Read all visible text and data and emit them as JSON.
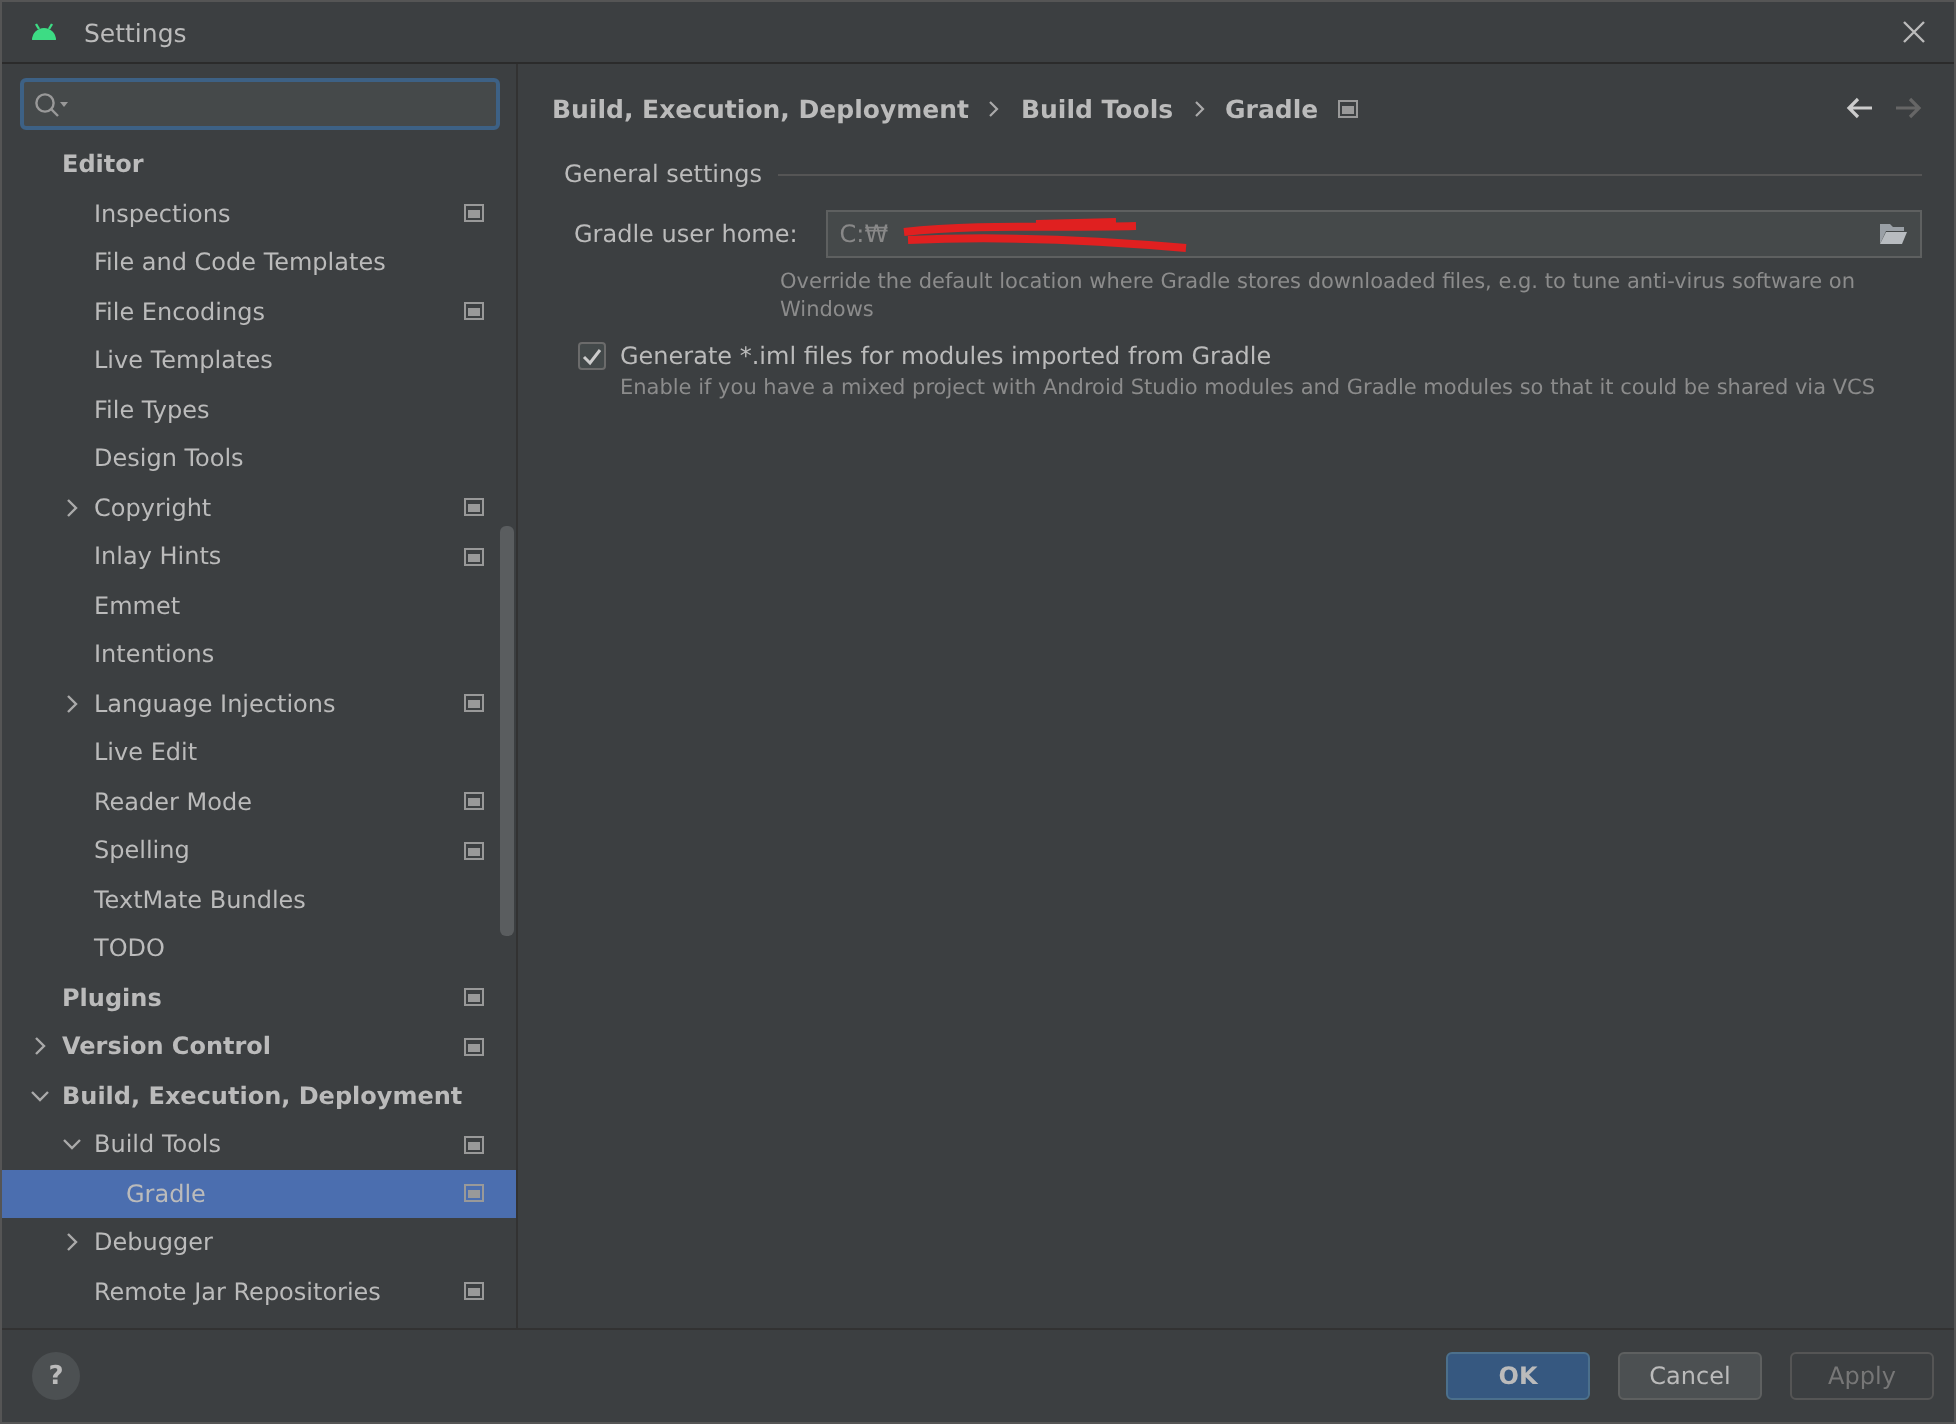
{
  "window": {
    "title": "Settings"
  },
  "tree": [
    {
      "label": "Editor",
      "kind": "leaf",
      "scoped": false,
      "selected": false,
      "children": [
        {
          "label": "Inspections",
          "kind": "leaf",
          "scoped": true,
          "selected": false
        },
        {
          "label": "File and Code Templates",
          "kind": "leaf",
          "scoped": false,
          "selected": false
        },
        {
          "label": "File Encodings",
          "kind": "leaf",
          "scoped": true,
          "selected": false
        },
        {
          "label": "Live Templates",
          "kind": "leaf",
          "scoped": false,
          "selected": false
        },
        {
          "label": "File Types",
          "kind": "leaf",
          "scoped": false,
          "selected": false
        },
        {
          "label": "Design Tools",
          "kind": "leaf",
          "scoped": false,
          "selected": false
        },
        {
          "label": "Copyright",
          "kind": "branch",
          "expanded": false,
          "scoped": true,
          "selected": false
        },
        {
          "label": "Inlay Hints",
          "kind": "leaf",
          "scoped": true,
          "selected": false
        },
        {
          "label": "Emmet",
          "kind": "leaf",
          "scoped": false,
          "selected": false
        },
        {
          "label": "Intentions",
          "kind": "leaf",
          "scoped": false,
          "selected": false
        },
        {
          "label": "Language Injections",
          "kind": "branch",
          "expanded": false,
          "scoped": true,
          "selected": false
        },
        {
          "label": "Live Edit",
          "kind": "leaf",
          "scoped": false,
          "selected": false
        },
        {
          "label": "Reader Mode",
          "kind": "leaf",
          "scoped": true,
          "selected": false
        },
        {
          "label": "Spelling",
          "kind": "leaf",
          "scoped": true,
          "selected": false
        },
        {
          "label": "TextMate Bundles",
          "kind": "leaf",
          "scoped": false,
          "selected": false
        },
        {
          "label": "TODO",
          "kind": "leaf",
          "scoped": false,
          "selected": false
        }
      ]
    },
    {
      "label": "Plugins",
      "kind": "leaf",
      "scoped": true,
      "selected": false
    },
    {
      "label": "Version Control",
      "kind": "branch",
      "expanded": false,
      "scoped": true,
      "selected": false
    },
    {
      "label": "Build, Execution, Deployment",
      "kind": "branch",
      "expanded": true,
      "scoped": false,
      "selected": false,
      "children": [
        {
          "label": "Build Tools",
          "kind": "branch",
          "expanded": true,
          "scoped": true,
          "selected": false,
          "children": [
            {
              "label": "Gradle",
              "kind": "leaf",
              "scoped": true,
              "selected": true
            }
          ]
        },
        {
          "label": "Debugger",
          "kind": "branch",
          "expanded": false,
          "scoped": false,
          "selected": false
        },
        {
          "label": "Remote Jar Repositories",
          "kind": "leaf",
          "scoped": true,
          "selected": false
        }
      ]
    }
  ],
  "breadcrumb": [
    "Build, Execution, Deployment",
    "Build Tools",
    "Gradle"
  ],
  "section": {
    "title": "General settings"
  },
  "gradle_home": {
    "label": "Gradle user home:",
    "value": "C:₩",
    "hint": "Override the default location where Gradle stores downloaded files, e.g. to tune anti-virus software on Windows"
  },
  "generate_iml": {
    "label": "Generate *.iml files for modules imported from Gradle",
    "checked": true,
    "hint": "Enable if you have a mixed project with Android Studio modules and Gradle modules so that it could be shared via VCS"
  },
  "buttons": [
    {
      "label": "OK",
      "kind": "default",
      "disabled": false
    },
    {
      "label": "Cancel",
      "kind": "normal",
      "disabled": false
    },
    {
      "label": "Apply",
      "kind": "normal",
      "disabled": true
    }
  ],
  "help": "?"
}
